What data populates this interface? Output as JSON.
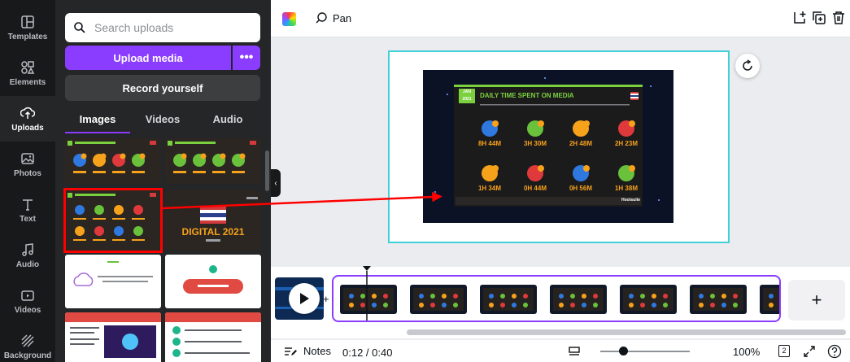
{
  "rail": [
    {
      "label": "Templates",
      "icon": "templates-icon"
    },
    {
      "label": "Elements",
      "icon": "elements-icon"
    },
    {
      "label": "Uploads",
      "icon": "uploads-icon"
    },
    {
      "label": "Photos",
      "icon": "photos-icon"
    },
    {
      "label": "Text",
      "icon": "text-icon"
    },
    {
      "label": "Audio",
      "icon": "audio-icon"
    },
    {
      "label": "Videos",
      "icon": "videos-icon"
    },
    {
      "label": "Background",
      "icon": "background-icon"
    }
  ],
  "panel": {
    "search_placeholder": "Search uploads",
    "upload_label": "Upload media",
    "more_label": "•••",
    "record_label": "Record yourself",
    "tabs": [
      "Images",
      "Videos",
      "Audio"
    ],
    "thumb_digital_title": "DIGITAL 2021"
  },
  "topbar": {
    "pan_label": "Pan"
  },
  "slide": {
    "badge": "JAN 2021",
    "title": "DAILY TIME SPENT ON MEDIA",
    "stats_row1": [
      "8H 44M",
      "3H 30M",
      "2H 48M",
      "2H 23M"
    ],
    "stats_row2": [
      "1H 34M",
      "0H 44M",
      "0H 56M",
      "1H 38M"
    ],
    "footer_brand": "Hootsuite"
  },
  "bottom": {
    "notes_label": "Notes",
    "timer": "0:12 / 0:40",
    "zoom": "100%",
    "page_count": "2"
  },
  "colors": {
    "accent": "#8b3dff",
    "page_border": "#40d0d6",
    "annotation": "#ff0000"
  }
}
